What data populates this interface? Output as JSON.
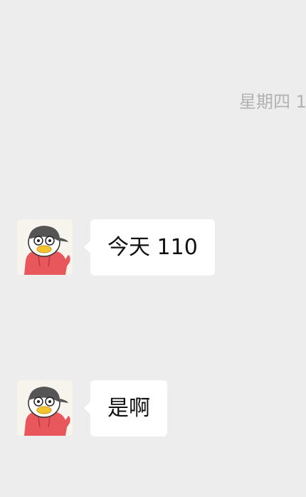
{
  "chat": {
    "timestamp": "星期四 1",
    "messages": [
      {
        "sender_avatar": "duck-avatar-icon",
        "text": "今天 110"
      },
      {
        "sender_avatar": "duck-avatar-icon",
        "text": "是啊"
      }
    ]
  },
  "colors": {
    "background": "#ededed",
    "bubble": "#ffffff",
    "timestamp": "#b2b2b2",
    "text": "#111111",
    "hoodie": "#e8575c"
  }
}
